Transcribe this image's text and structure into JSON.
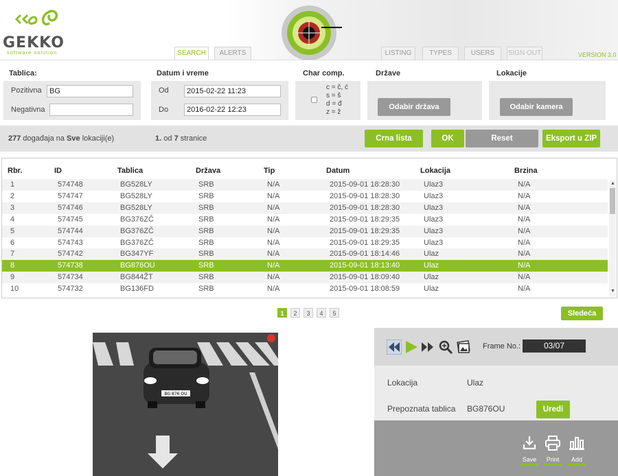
{
  "app": {
    "logo": "GEKKO",
    "logo_sub": "software solution",
    "version": "VERSION 3.0"
  },
  "tabs": [
    {
      "label": "SEARCH",
      "active": true
    },
    {
      "label": "ALERTS",
      "active": false
    },
    {
      "label": "LISTING",
      "active": false
    },
    {
      "label": "TYPES",
      "active": false
    },
    {
      "label": "USERS",
      "active": false
    },
    {
      "label": "SIGN OUT",
      "active": false
    }
  ],
  "filters": {
    "tablica": {
      "title": "Tablica:",
      "pozitivna_label": "Pozitivna",
      "pozitivna_value": "BG",
      "negativna_label": "Negativna",
      "negativna_value": ""
    },
    "datum": {
      "title": "Datum i vreme",
      "od_label": "Od",
      "od_value": "2015-02-22 11:23",
      "do_label": "Do",
      "do_value": "2016-02-22 12:23"
    },
    "charcomp": {
      "title": "Char comp.",
      "lines": [
        "c = č, ć",
        "s = š",
        "d = đ",
        "z = ž"
      ]
    },
    "drzave": {
      "title": "Države",
      "button": "Odabir država"
    },
    "lokacije": {
      "title": "Lokacije",
      "button": "Odabir kamera"
    }
  },
  "status": {
    "count": "277",
    "count_text_a": "događaja na",
    "scope": "Sve",
    "count_text_b": "lokaciji(e)",
    "page": "1.",
    "page_text_a": "od",
    "pages": "7",
    "page_text_b": "stranice"
  },
  "actions": {
    "crna_lista": "Crna lista",
    "ok": "OK",
    "reset": "Reset",
    "eksport": "Eksport u ZIP"
  },
  "table": {
    "columns": [
      "Rbr.",
      "ID",
      "Tablica",
      "Država",
      "Tip",
      "Datum",
      "Lokacija",
      "Brzina"
    ],
    "rows": [
      [
        "1",
        "574748",
        "BG528LY",
        "SRB",
        "N/A",
        "2015-09-01 18:28:30",
        "Ulaz3",
        "N/A"
      ],
      [
        "2",
        "574747",
        "BG528LY",
        "SRB",
        "N/A",
        "2015-09-01 18:28:30",
        "Ulaz3",
        "N/A"
      ],
      [
        "3",
        "574746",
        "BG528LY",
        "SRB",
        "N/A",
        "2015-09-01 18:28:30",
        "Ulaz3",
        "N/A"
      ],
      [
        "4",
        "574745",
        "BG376ZČ",
        "SRB",
        "N/A",
        "2015-09-01 18:29:35",
        "Ulaz3",
        "N/A"
      ],
      [
        "5",
        "574744",
        "BG376ZČ",
        "SRB",
        "N/A",
        "2015-09-01 18:29:35",
        "Ulaz3",
        "N/A"
      ],
      [
        "6",
        "574743",
        "BG376ZČ",
        "SRB",
        "N/A",
        "2015-09-01 18:29:35",
        "Ulaz3",
        "N/A"
      ],
      [
        "7",
        "574742",
        "BG347YF",
        "SRB",
        "N/A",
        "2015-09-01 18:14:46",
        "Ulaz",
        "N/A"
      ],
      [
        "8",
        "574738",
        "BG876OU",
        "SRB",
        "N/A",
        "2015-09-01 18:13:40",
        "Ulaz",
        "N/A"
      ],
      [
        "9",
        "574734",
        "BG844ŽT",
        "SRB",
        "N/A",
        "2015-09-01 18:09:40",
        "Ulaz",
        "N/A"
      ],
      [
        "10",
        "574732",
        "BG136FD",
        "SRB",
        "N/A",
        "2015-09-01 18:08:59",
        "Ulaz",
        "N/A"
      ]
    ],
    "selected_row": 8
  },
  "pagination": {
    "pages": [
      "1",
      "2",
      "3",
      "4",
      "5"
    ],
    "current": "1",
    "next": "Sledeća"
  },
  "viewer": {
    "frame_label": "Frame No.:",
    "frame_value": "03/07",
    "plate_in_image": "BG 876 OU",
    "lokacija_label": "Lokacija",
    "lokacija_value": "Ulaz",
    "tablica_label": "Prepoznata tablica",
    "tablica_value": "BG876OU",
    "uredi": "Uredi",
    "save": "Save",
    "print": "Print",
    "add": "Add"
  },
  "colors": {
    "accent": "#8cbf26",
    "grey_button": "#999999",
    "panel": "#e9e9e9"
  }
}
